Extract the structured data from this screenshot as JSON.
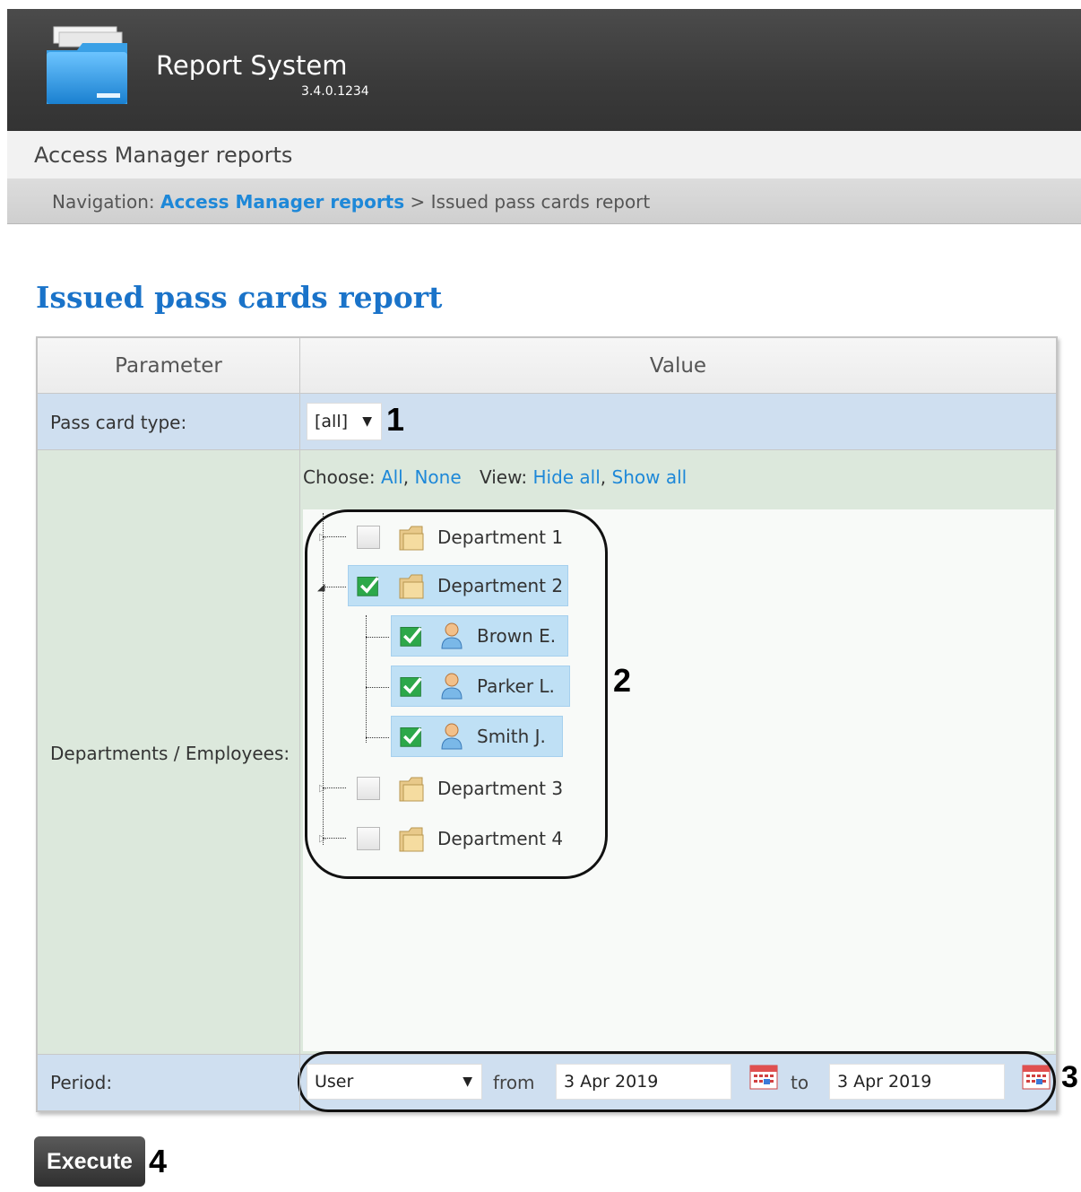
{
  "header": {
    "app_title": "Report System",
    "version": "3.4.0.1234",
    "logo_icon": "folder-box-icon"
  },
  "subheader": {
    "title": "Access Manager reports"
  },
  "navigation": {
    "label": "Navigation:",
    "link": "Access Manager reports",
    "separator": ">",
    "current": "Issued pass cards report"
  },
  "page": {
    "heading": "Issued pass cards report"
  },
  "table": {
    "headers": [
      "Parameter",
      "Value"
    ],
    "pass_card_type": {
      "label": "Pass card type:",
      "value": "[all]",
      "callout": "1"
    },
    "departments": {
      "label": "Departments / Employees:",
      "choose_label": "Choose:",
      "choose_all": "All",
      "choose_none": "None",
      "view_label": "View:",
      "hide_all": "Hide all",
      "show_all": "Show all",
      "callout": "2",
      "tree": [
        {
          "label": "Department 1",
          "type": "department",
          "checked": false
        },
        {
          "label": "Department 2",
          "type": "department",
          "checked": true,
          "expanded": true,
          "children": [
            {
              "label": "Brown E.",
              "type": "employee",
              "checked": true
            },
            {
              "label": "Parker L.",
              "type": "employee",
              "checked": true
            },
            {
              "label": "Smith J.",
              "type": "employee",
              "checked": true
            }
          ]
        },
        {
          "label": "Department 3",
          "type": "department",
          "checked": false
        },
        {
          "label": "Department 4",
          "type": "department",
          "checked": false
        }
      ]
    },
    "period": {
      "label": "Period:",
      "mode": "User",
      "from_label": "from",
      "from_date": "3 Apr 2019",
      "to_label": "to",
      "to_date": "3 Apr 2019",
      "callout": "3"
    }
  },
  "execute": {
    "label": "Execute",
    "callout": "4"
  },
  "colors": {
    "link": "#1e88d8",
    "heading": "#1a73c9",
    "header_bg": "#3a3a3a",
    "row_blue": "#cfdff0",
    "row_green": "#dce8dc",
    "selected": "#bfe0f5"
  }
}
